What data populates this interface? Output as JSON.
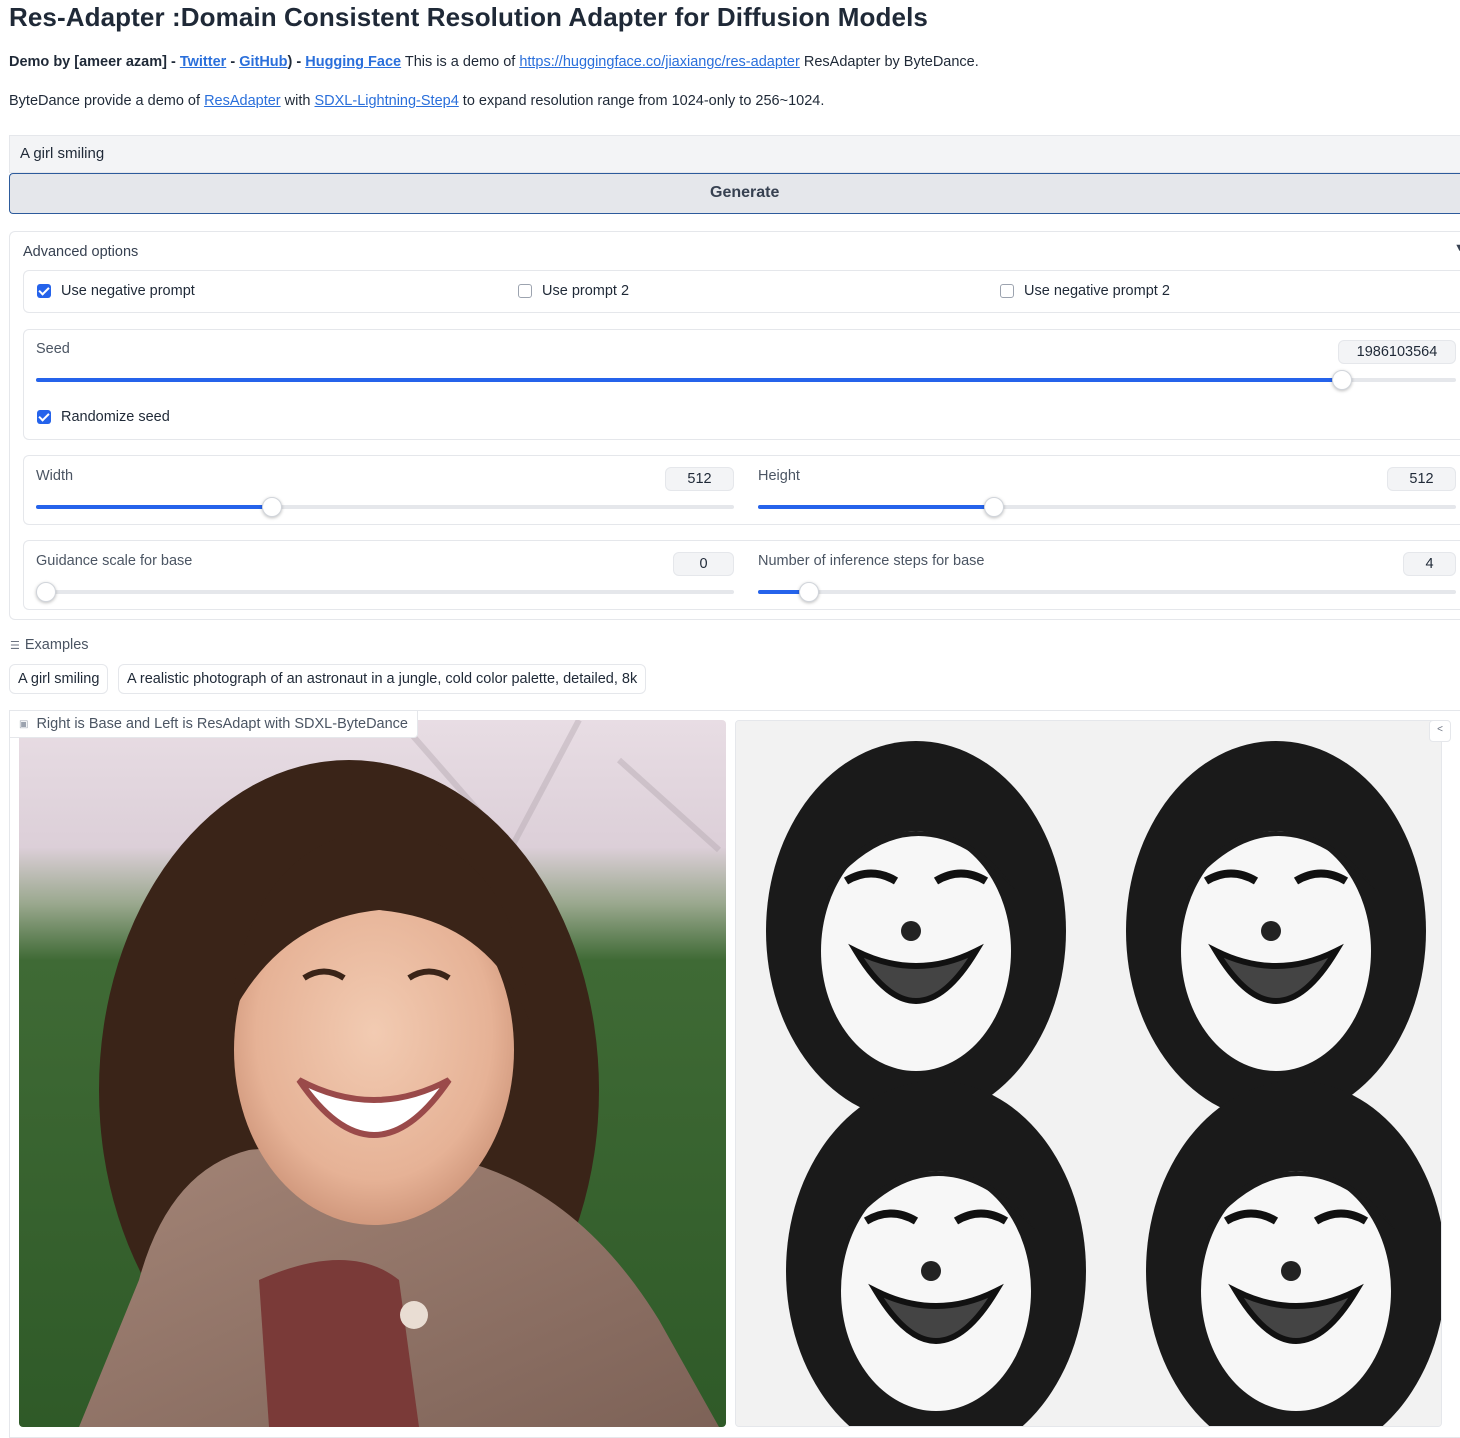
{
  "title": "Res-Adapter :Domain Consistent Resolution Adapter for Diffusion Models",
  "intro": {
    "demo_by": "Demo by [ameer azam] - ",
    "twitter": "Twitter",
    "sep1": " - ",
    "github": "GitHub",
    "sep2": ") - ",
    "huggingface": "Hugging Face",
    "text1": " This is a demo of ",
    "repo_link": "https://huggingface.co/jiaxiangc/res-adapter",
    "text2": " ResAdapter by ByteDance."
  },
  "intro2": {
    "text1": "ByteDance provide a demo of ",
    "resadapter_link": "ResAdapter",
    "text2": " with ",
    "sdxl_link": "SDXL-Lightning-Step4",
    "text3": " to expand resolution range from 1024-only to 256~1024."
  },
  "prompt": {
    "value": "A girl smiling"
  },
  "generate_label": "Generate",
  "advanced": {
    "header": "Advanced options",
    "arrow": "▼",
    "checkboxes": [
      {
        "label": "Use negative prompt",
        "checked": true
      },
      {
        "label": "Use prompt 2",
        "checked": false
      },
      {
        "label": "Use negative prompt 2",
        "checked": false
      }
    ],
    "seed": {
      "label": "Seed",
      "value": "1986103564",
      "fraction": 0.9196
    },
    "randomize": {
      "label": "Randomize seed",
      "checked": true
    },
    "width": {
      "label": "Width",
      "value": "512",
      "fraction": 0.3386
    },
    "height": {
      "label": "Height",
      "value": "512",
      "fraction": 0.3386
    },
    "guidance": {
      "label": "Guidance scale for base",
      "value": "0",
      "fraction": 0.0
    },
    "steps": {
      "label": "Number of inference steps for base",
      "value": "4",
      "fraction": 0.0732
    }
  },
  "examples": {
    "header": "Examples",
    "items": [
      "A girl smiling",
      "A realistic photograph of an astronaut in a jungle, cold color palette, detailed, 8k"
    ]
  },
  "gallery": {
    "label": "Right is Base and Left is ResAdapt with SDXL-ByteDance"
  },
  "colors": {
    "accent": "#2563eb",
    "link": "#2a6fdb"
  }
}
